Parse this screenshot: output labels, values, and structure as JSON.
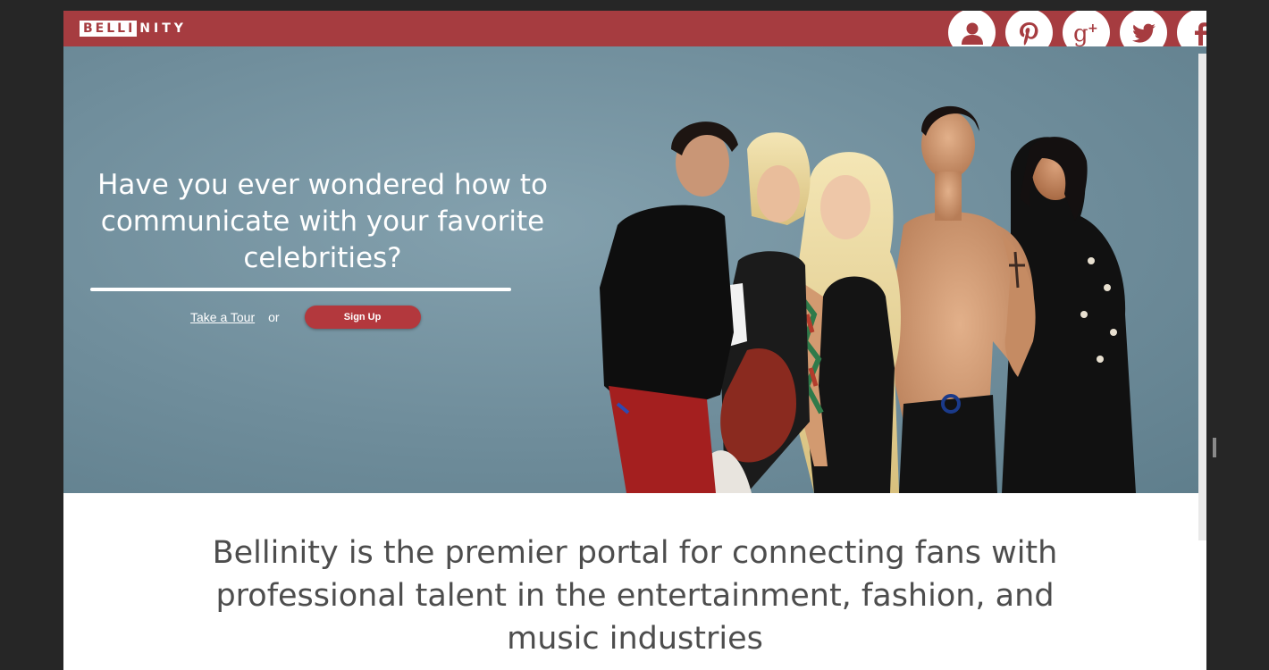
{
  "header": {
    "logo_boxed": "BELLI",
    "logo_rest": "NITY",
    "logo_full": "BELLINITY",
    "social": [
      {
        "name": "user-icon"
      },
      {
        "name": "pinterest-icon"
      },
      {
        "name": "google-plus-icon"
      },
      {
        "name": "twitter-icon"
      },
      {
        "name": "facebook-icon"
      }
    ],
    "bar_color": "#a63c40"
  },
  "hero": {
    "headline_line1": "Have you ever wondered how to",
    "headline_line2": "communicate with your favorite",
    "headline_line3": "celebrities?",
    "tour_link": "Take a Tour",
    "or_text": "or",
    "signup_label": "Sign Up",
    "bg_color": "#6f8d9b",
    "button_color": "#b3383d"
  },
  "intro": {
    "line1": "Bellinity is the premier portal for connecting fans with",
    "line2": "professional talent in the entertainment, fashion, and",
    "line3": "music industries"
  }
}
